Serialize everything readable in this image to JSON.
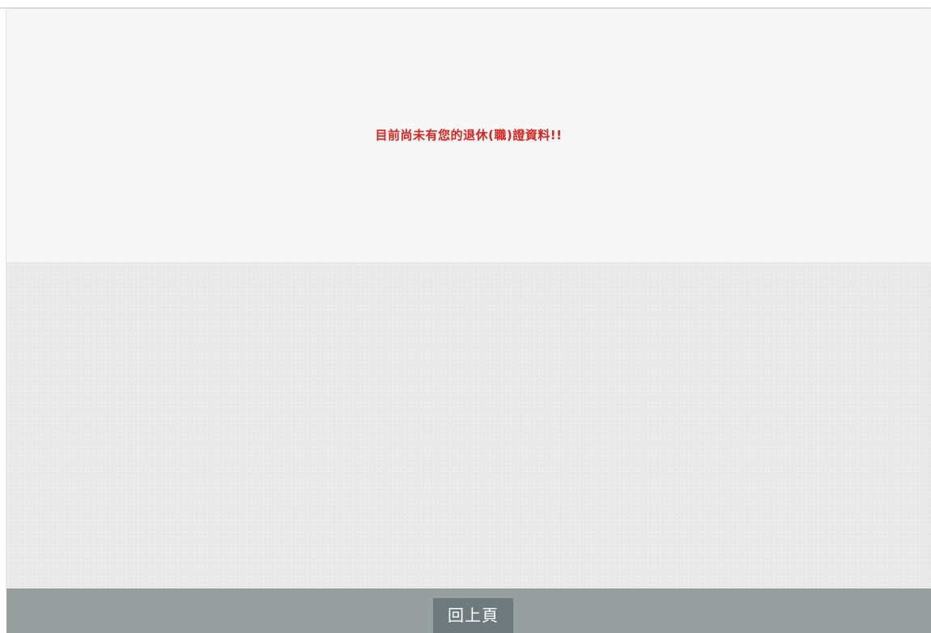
{
  "message": {
    "text": "目前尚未有您的退休(職)證資料!!",
    "color": "#e0201b"
  },
  "footer": {
    "back_button_label": "回上頁",
    "bar_color": "#98a09f",
    "button_color": "#6f7a7e"
  }
}
